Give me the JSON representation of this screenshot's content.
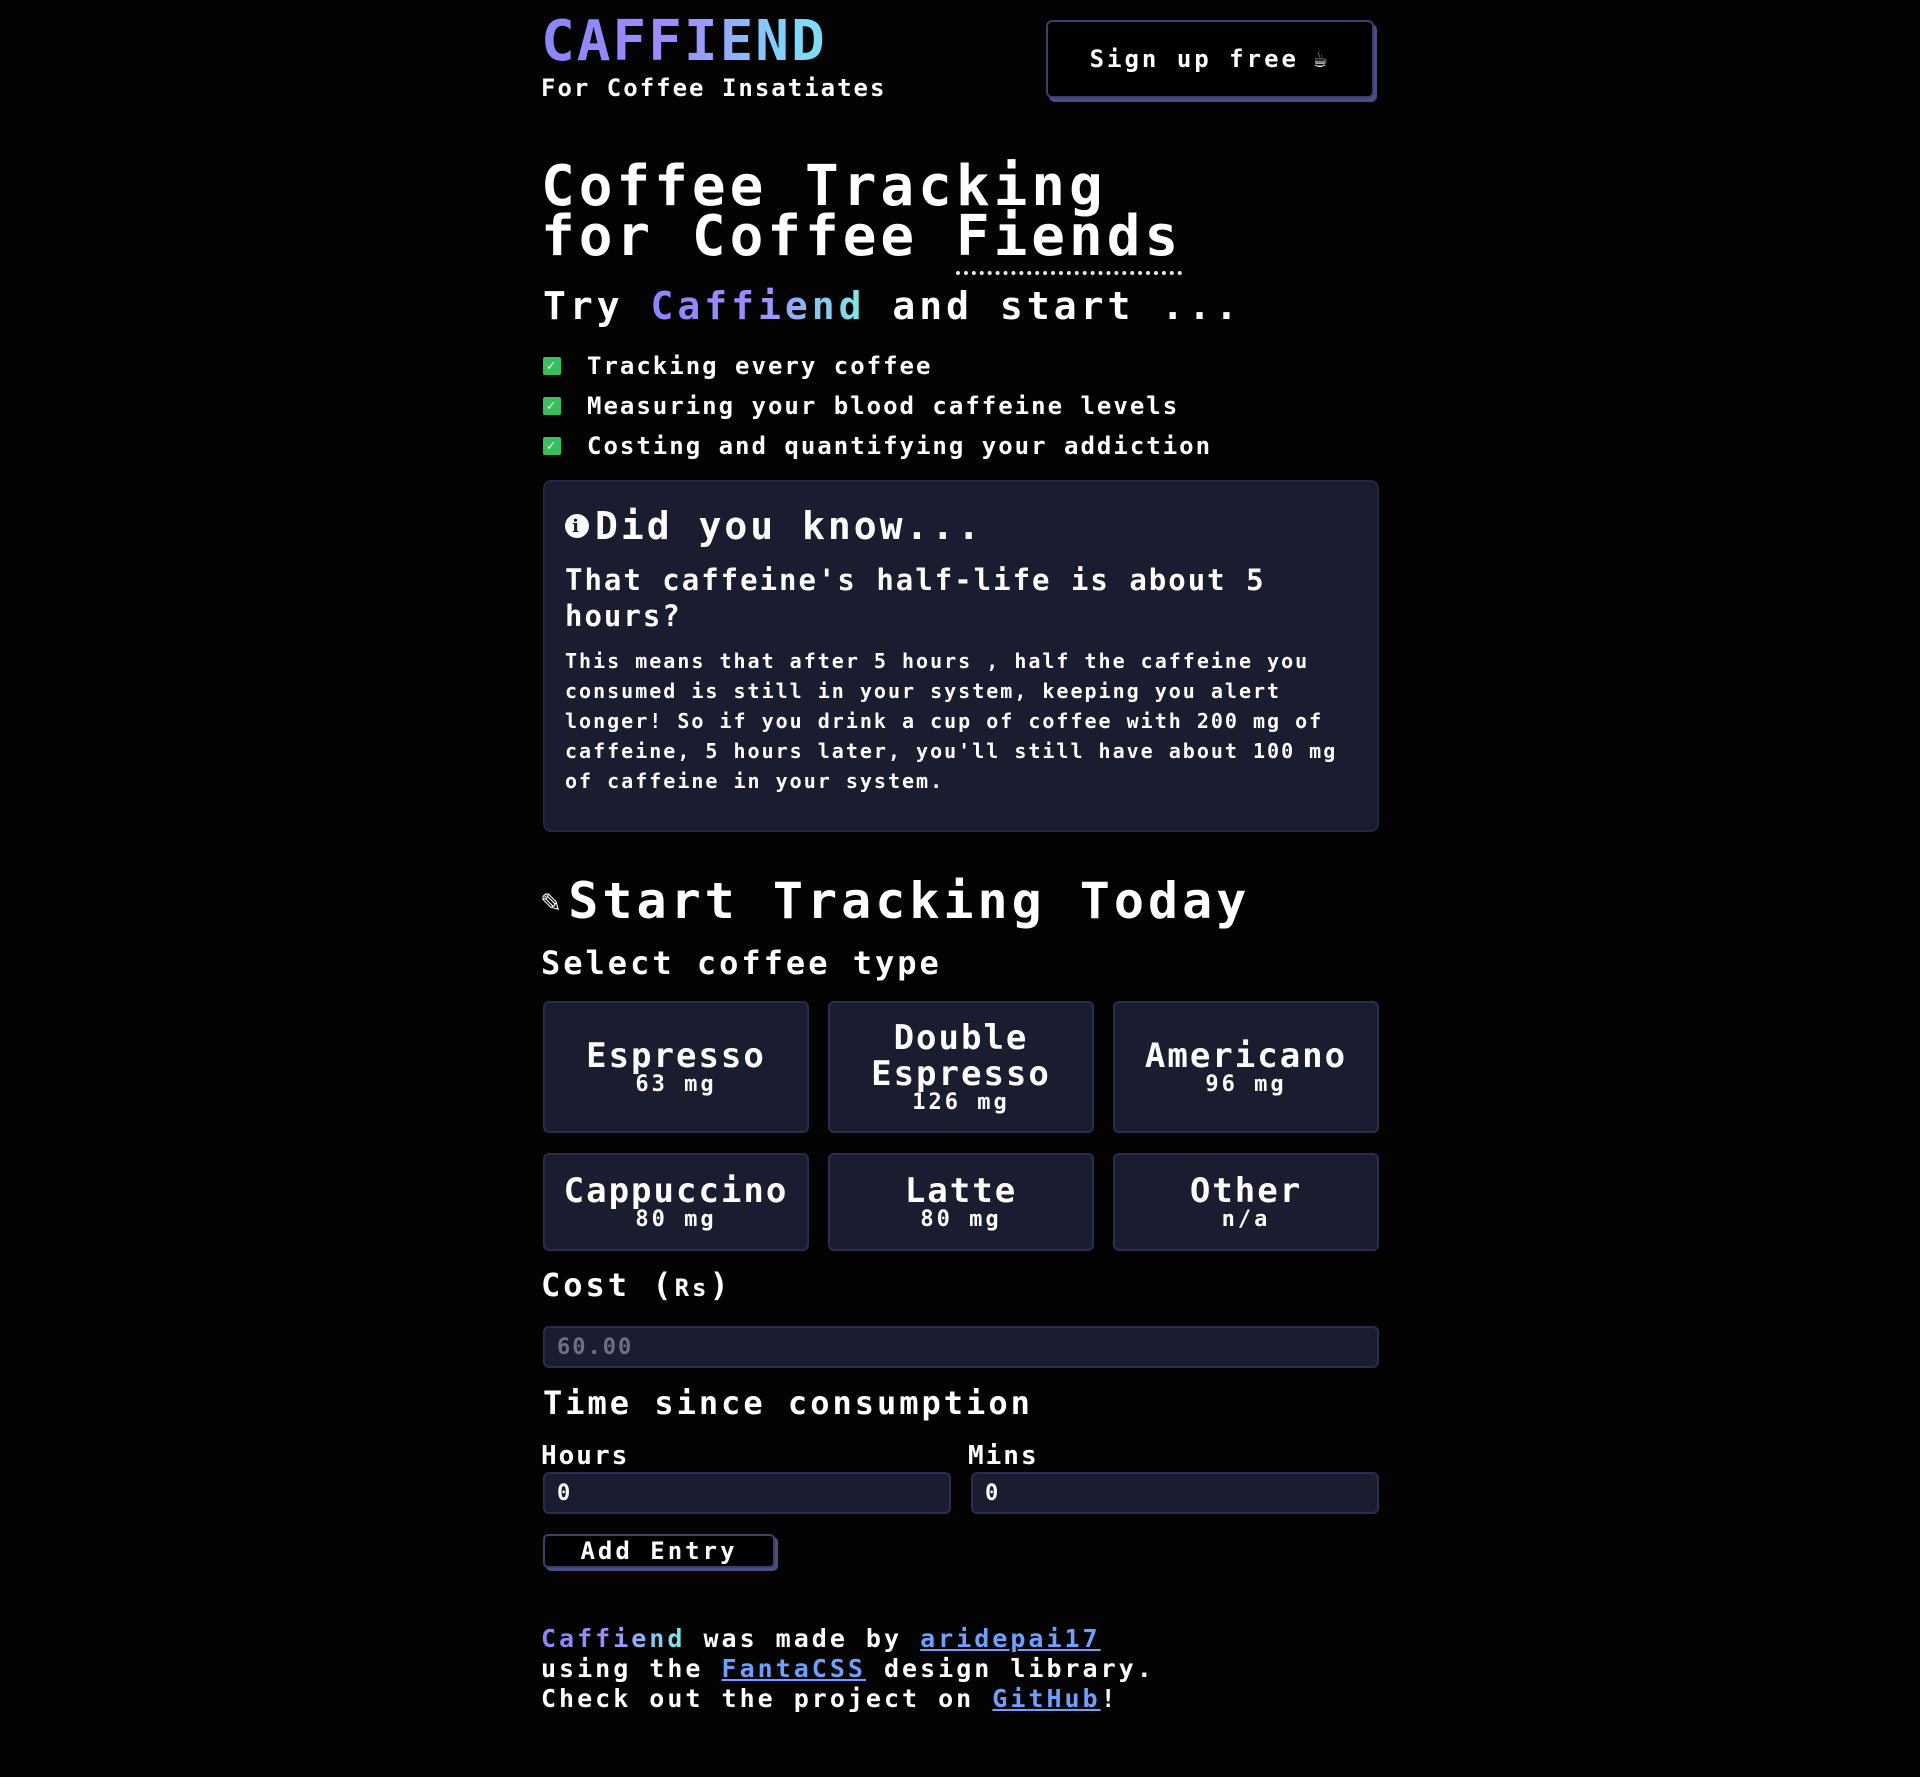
{
  "header": {
    "brand": "CAFFIEND",
    "tagline": "For Coffee Insatiates",
    "signup_label": "Sign up free",
    "signup_icon": "coffee-cup-icon"
  },
  "hero": {
    "title_line1": "Coffee Tracking",
    "title_line2_prefix": "for Coffee ",
    "title_line2_emphasis": "Fiends",
    "subtitle_prefix": "Try ",
    "subtitle_brand": "Caffiend",
    "subtitle_suffix": " and start ...",
    "features": [
      "Tracking every coffee",
      "Measuring your blood caffeine levels",
      "Costing and quantifying your addiction"
    ],
    "check_color": "#35c05c"
  },
  "fact_card": {
    "heading": "Did you know...",
    "question": "That caffeine's half-life is about 5 hours?",
    "body": "This means that after 5 hours , half the caffeine you consumed is still in your system, keeping you alert longer! So if you drink a cup of coffee with 200 mg of caffeine, 5 hours later, you'll still have about 100 mg of caffeine in your system."
  },
  "tracker": {
    "title": "Start Tracking Today",
    "select_label": "Select coffee type",
    "coffee_types": [
      {
        "name": "Espresso",
        "mg": "63 mg"
      },
      {
        "name": "Double Espresso",
        "mg": "126 mg"
      },
      {
        "name": "Americano",
        "mg": "96 mg"
      },
      {
        "name": "Cappuccino",
        "mg": "80 mg"
      },
      {
        "name": "Latte",
        "mg": "80 mg"
      },
      {
        "name": "Other",
        "mg": "n/a"
      }
    ],
    "cost_label": "Cost",
    "cost_currency": "Rs",
    "cost_placeholder": "60.00",
    "time_label": "Time since consumption",
    "hours_label": "Hours",
    "hours_value": "0",
    "mins_label": "Mins",
    "mins_value": "0",
    "add_label": "Add Entry"
  },
  "footer": {
    "brand": "Caffiend",
    "made_by": " was made by ",
    "author": "aridepai17",
    "using": "using the ",
    "library": "FantaCSS",
    "library_suffix": " design library.",
    "check_out": "Check out the project on ",
    "github": "GitHub",
    "end": "!"
  },
  "colors": {
    "background": "#030303",
    "card": "#1a1c30",
    "link": "#6ea0ff",
    "brand_gradient_start": "#8b85ff",
    "brand_gradient_end": "#78f0e6"
  }
}
